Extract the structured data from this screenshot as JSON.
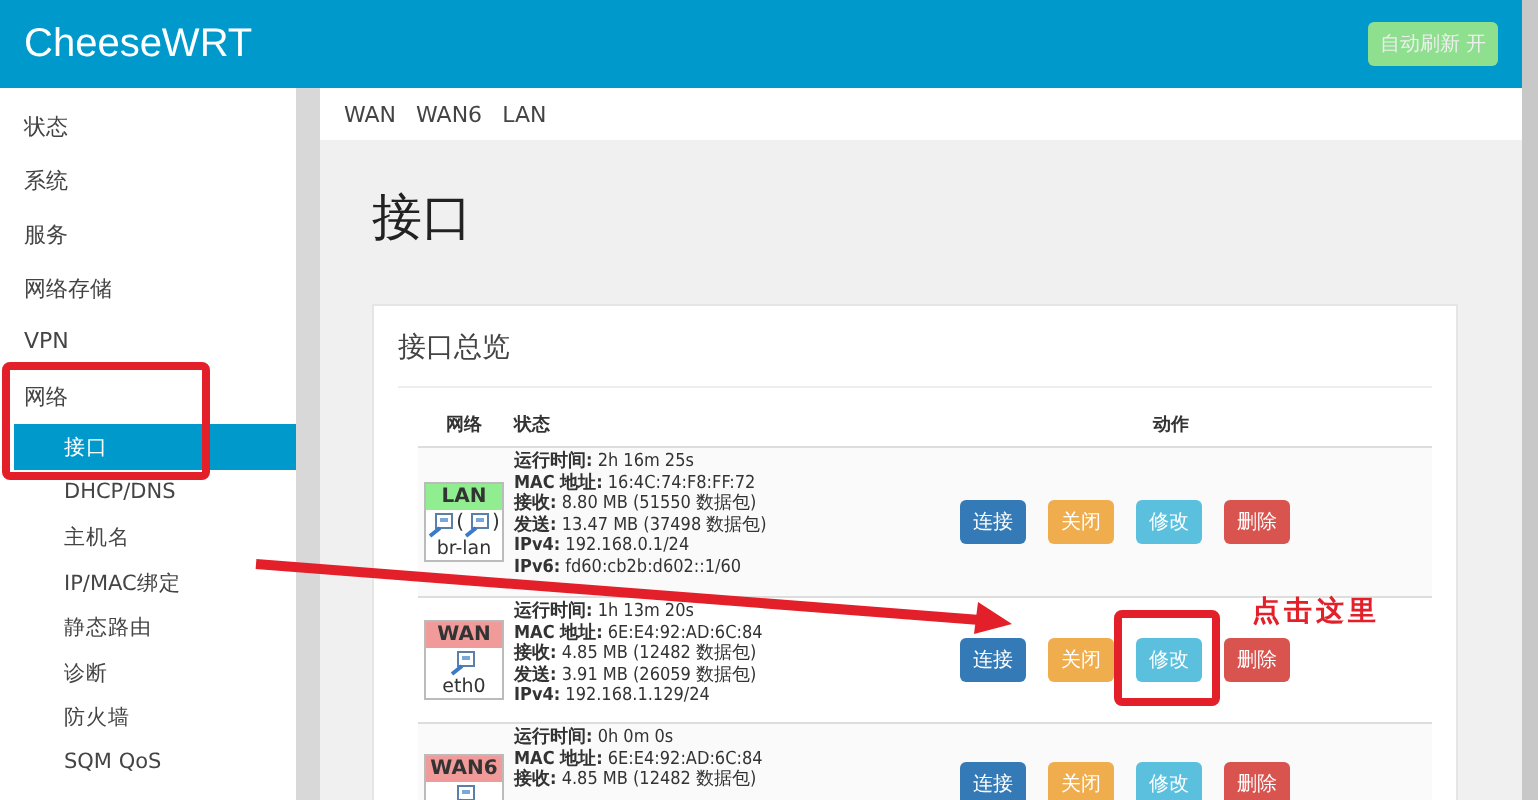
{
  "header": {
    "title": "CheeseWRT",
    "auto_refresh": {
      "label": "自动刷新 开",
      "on": true
    }
  },
  "sidebar": {
    "items": [
      {
        "label": "状态",
        "selected": false
      },
      {
        "label": "系统",
        "selected": false
      },
      {
        "label": "服务",
        "selected": false
      },
      {
        "label": "网络存储",
        "selected": false
      },
      {
        "label": "VPN",
        "selected": false
      },
      {
        "label": "网络",
        "selected": false,
        "children": [
          {
            "label": "接口",
            "selected": true
          },
          {
            "label": "DHCP/DNS",
            "selected": false
          },
          {
            "label": "主机名",
            "selected": false
          },
          {
            "label": "IP/MAC绑定",
            "selected": false
          },
          {
            "label": "静态路由",
            "selected": false
          },
          {
            "label": "诊断",
            "selected": false
          },
          {
            "label": "防火墙",
            "selected": false
          },
          {
            "label": "SQM QoS",
            "selected": false
          }
        ]
      }
    ]
  },
  "tabs": [
    {
      "label": "WAN"
    },
    {
      "label": "WAN6"
    },
    {
      "label": "LAN"
    }
  ],
  "page_title": "接口",
  "card": {
    "title": "接口总览",
    "columns": [
      "网络",
      "状态",
      "动作"
    ],
    "rows": [
      {
        "network": "LAN",
        "color": "#90ee90",
        "device": "br-lan",
        "bridge": {
          "open": "(",
          "close": ")"
        },
        "info": [
          "**运行时间:** 2h 16m 25s",
          "**MAC 地址:** 16:4C:74:F8:FF:72",
          "**接收:** 8.80 MB (51550 数据包)",
          "**发送:** 13.47 MB (37498 数据包)",
          "**IPv4:** 192.168.0.1/24",
          "**IPv6:** fd60:cb2b:d602::1/60"
        ],
        "actions": [
          {
            "label": "连接",
            "kind": "connect"
          },
          {
            "label": "关闭",
            "kind": "stop"
          },
          {
            "label": "修改",
            "kind": "edit"
          },
          {
            "label": "删除",
            "kind": "delete"
          }
        ]
      },
      {
        "network": "WAN",
        "color": "#f09a9a",
        "device": "eth0",
        "info": [
          "**运行时间:** 1h 13m 20s",
          "**MAC 地址:** 6E:E4:92:AD:6C:84",
          "**接收:** 4.85 MB (12482 数据包)",
          "**发送:** 3.91 MB (26059 数据包)",
          "**IPv4:** 192.168.1.129/24"
        ],
        "actions": [
          {
            "label": "连接",
            "kind": "connect"
          },
          {
            "label": "关闭",
            "kind": "stop"
          },
          {
            "label": "修改",
            "kind": "edit"
          },
          {
            "label": "删除",
            "kind": "delete"
          }
        ]
      },
      {
        "network": "WAN6",
        "color": "#f09a9a",
        "info": [
          "**运行时间:** 0h 0m 0s",
          "**MAC 地址:** 6E:E4:92:AD:6C:84",
          "**接收:** 4.85 MB (12482 数据包)"
        ],
        "actions": [
          {
            "label": "连接",
            "kind": "connect"
          },
          {
            "label": "关闭",
            "kind": "stop"
          },
          {
            "label": "修改",
            "kind": "edit"
          },
          {
            "label": "删除",
            "kind": "delete"
          }
        ]
      }
    ]
  },
  "annotation": {
    "callout": "点击这里"
  }
}
